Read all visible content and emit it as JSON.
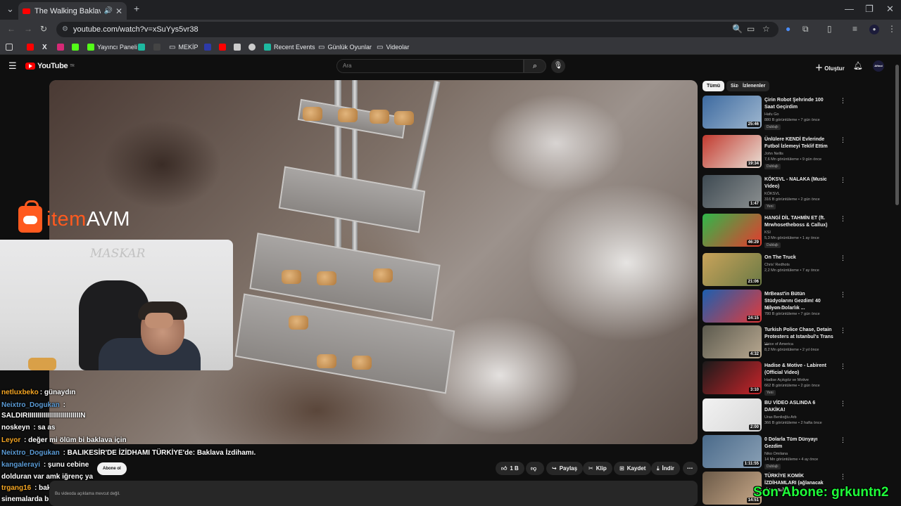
{
  "browser": {
    "tab_title": "The Walking Baklavas Episo",
    "tab_close": "✕",
    "new_tab": "+",
    "url": "youtube.com/watch?v=xSuYys5vr38",
    "bookmarks": [
      {
        "label": "Yayıncı Paneli"
      },
      {
        "label": "MEKİP"
      },
      {
        "label": "Recent Events"
      },
      {
        "label": "Günlük Oyunlar"
      },
      {
        "label": "Videolar"
      }
    ]
  },
  "youtube": {
    "logo": "YouTube",
    "logo_sup": "TR",
    "search_placeholder": "Ara",
    "create_label": "Oluştur",
    "avatar_text": "Aftnoi"
  },
  "overlay": {
    "brand_prefix": "item",
    "brand_suffix": "AVM",
    "webcam_watermark": "MASKAR",
    "promo": "Son Abone: grkuntn2"
  },
  "chat": [
    {
      "user": "netluxbeko",
      "user_color": "#f5a623",
      "msg": ": günaydın"
    },
    {
      "user": "Neixtro_Dogukan",
      "user_color": "#5b9bd5",
      "msg": " :"
    },
    {
      "user": "",
      "user_color": "#ffffff",
      "msg": "SALDIRIIIIIIIIIIIIIIIIIIIIIIIIIIIN"
    },
    {
      "user": "noskeyn",
      "user_color": "#ffffff",
      "msg": " : sa as"
    },
    {
      "user": "Leyor",
      "user_color": "#f5a623",
      "msg": " : değer mi ölüm bi baklava için"
    },
    {
      "user": "Neixtro_Dogukan",
      "user_color": "#5b9bd5",
      "msg": " : BALIKESİR'DE İZİDHAMI TÜRKİYE'de: Baklava İzdihamı."
    },
    {
      "user": "kangalerayi",
      "user_color": "#5b9bd5",
      "msg": " : şunu cebine"
    },
    {
      "user": "",
      "user_color": "#ffffff",
      "msg": "dolduran var amk iğrenç ya"
    },
    {
      "user": "trgang16",
      "user_color": "#f5a623",
      "msg": " : baklava izdihamı şimdi"
    },
    {
      "user": "",
      "user_color": "#ffffff",
      "msg": "sinemalarda biletler biletx de"
    }
  ],
  "video_actions": {
    "subscribe": "Abone ol",
    "likes": "1 B",
    "share": "Paylaş",
    "clip": "Klip",
    "save": "Kaydet",
    "download": "İndir",
    "description_empty": "Bu videoda açıklama mevcut değil."
  },
  "sidebar": {
    "chips": [
      "Tümü",
      "Size özel",
      "İzlenenler"
    ],
    "recs": [
      {
        "title": "Çirin Robot Şehrinde 100 Saat Geçirdim",
        "channel": "Hafu Go",
        "meta": "880 B görüntüleme • 7 gün önce",
        "badge": "Dublajlı",
        "dur": "25:46",
        "c1": "#3d6aa0",
        "c2": "#9fb7cf"
      },
      {
        "title": "Ünlülere KENDİ Evlerinde Futbol İzlemeyi Teklif Ettim",
        "channel": "John Nellis",
        "meta": "7,6 Mn görüntüleme • 9 gün önce",
        "badge": "Dublajlı",
        "dur": "19:34",
        "c1": "#c23a2f",
        "c2": "#e9e0d6"
      },
      {
        "title": "KÖKSVL - NALAKA (Music Video)",
        "channel": "KÖKSVL",
        "meta": "316 B görüntüleme • 2 gün önce",
        "badge": "Yeni",
        "dur": "1:47",
        "c1": "#3e4a52",
        "c2": "#8b8f90"
      },
      {
        "title": "HANGİ DİL TAHMİN ET (ft. Mrwhosetheboss & Callux)",
        "channel": "KSI",
        "meta": "5,3 Mn görüntüleme • 1 ay önce",
        "badge": "Dublajlı",
        "dur": "46:29",
        "c1": "#2fb84a",
        "c2": "#e63a2e"
      },
      {
        "title": "On The Truck",
        "channel": "Chris' Redhots",
        "meta": "2,2 Mn görüntüleme • 7 ay önce",
        "badge": "",
        "dur": "21:06",
        "c1": "#c9a35a",
        "c2": "#6b7a45"
      },
      {
        "title": "MrBeast'in Bütün Stüdyolarını Gezdim! 40 Milyon Dolarlık ...",
        "channel": "Alper Rende",
        "meta": "780 B görüntüleme • 7 gün önce",
        "badge": "",
        "dur": "24:15",
        "c1": "#1c5fb0",
        "c2": "#e23a3a"
      },
      {
        "title": "Turkish Police Chase, Detain Protesters at Istanbul's Trans ...",
        "channel": "Voice of America",
        "meta": "8,2 Mn görüntüleme • 2 yıl önce",
        "badge": "",
        "dur": "4:32",
        "c1": "#5c5a4e",
        "c2": "#b8a890"
      },
      {
        "title": "Hadise & Motive - Labirent (Official Video)",
        "channel": "Hadise Açıkgöz ve Motive",
        "meta": "662 B görüntüleme • 2 gün önce",
        "badge": "Yeni",
        "dur": "3:10",
        "c1": "#1a1a1a",
        "c2": "#c9242a"
      },
      {
        "title": "BU VİDEO ASLINDA 6 DAKİKA!",
        "channel": "Uras Benlioğlu Arb",
        "meta": "366 B görüntüleme • 2 hafta önce",
        "badge": "",
        "dur": "2:00",
        "c1": "#f2f2f2",
        "c2": "#d8d8d8"
      },
      {
        "title": "0 Dolarla Tüm Dünyayı Gezdim",
        "channel": "Niko Omilana",
        "meta": "14 Mn görüntüleme • 4 ay önce",
        "badge": "Dublajlı",
        "dur": "1:11:55",
        "c1": "#4a6a8a",
        "c2": "#8aa0b5"
      },
      {
        "title": "TÜRKİYE KOMİK İZDİHAMLARI (ağlanacak durum..)",
        "channel": "Emre Bakır",
        "meta": "",
        "badge": "",
        "dur": "14:51",
        "c1": "#6b5a48",
        "c2": "#c8a888"
      }
    ]
  }
}
